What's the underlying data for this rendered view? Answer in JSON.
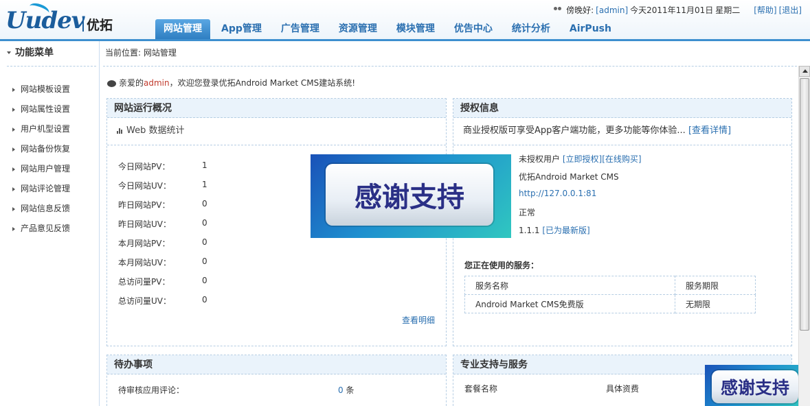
{
  "logo": {
    "brand_latin": "Uudev",
    "brand_cn": "优拓"
  },
  "userbar": {
    "greeting": "傍晚好:",
    "username": "[admin]",
    "date": "今天2011年11月01日",
    "weekday": "星期二",
    "help": "[帮助]",
    "logout": "[退出]"
  },
  "nav": [
    {
      "label": "网站管理",
      "active": true
    },
    {
      "label": "App管理"
    },
    {
      "label": "广告管理"
    },
    {
      "label": "资源管理"
    },
    {
      "label": "模块管理"
    },
    {
      "label": "优告中心"
    },
    {
      "label": "统计分析"
    },
    {
      "label": "AirPush"
    }
  ],
  "sidebar": {
    "title": "功能菜单",
    "items": [
      "网站模板设置",
      "网站属性设置",
      "用户机型设置",
      "网站备份恢复",
      "网站用户管理",
      "网站评论管理",
      "网站信息反馈",
      "产品意见反馈"
    ]
  },
  "breadcrumb": "当前位置: 网站管理",
  "welcome": {
    "prefix": "亲爱的",
    "user": "admin",
    "suffix": "，欢迎您登录优拓Android Market CMS建站系统!"
  },
  "overview": {
    "title": "网站运行概况",
    "subtitle": "Web 数据统计",
    "stats": [
      {
        "label": "今日网站PV：",
        "value": "1"
      },
      {
        "label": "今日网站UV：",
        "value": "1"
      },
      {
        "label": "昨日网站PV：",
        "value": "0"
      },
      {
        "label": "昨日网站UV：",
        "value": "0"
      },
      {
        "label": "本月网站PV：",
        "value": "0"
      },
      {
        "label": "本月网站UV：",
        "value": "0"
      },
      {
        "label": "总访问量PV：",
        "value": "0"
      },
      {
        "label": "总访问量UV：",
        "value": "0"
      }
    ],
    "more": "查看明细"
  },
  "license": {
    "title": "授权信息",
    "subtitle": "商业授权版可享受App客户端功能，更多功能等你体验...",
    "subtitle_link": "[查看详情]",
    "status_text": "未授权用户",
    "auth_link": "[立即授权]",
    "buy_link": "[在线购买]",
    "product": "优拓Android Market CMS",
    "url": "http://127.0.0.1:81",
    "state": "正常",
    "version": "1.1.1",
    "version_link": "[已为最新版]",
    "services_title": "您正在使用的服务：",
    "services_header": [
      "服务名称",
      "服务期限"
    ],
    "services_rows": [
      [
        "Android Market CMS免费版",
        "无期限"
      ]
    ]
  },
  "todo": {
    "title": "待办事项",
    "row_label": "待审核应用评论：",
    "row_count": "0",
    "row_unit": "条"
  },
  "support": {
    "title": "专业支持与服务",
    "col1": "套餐名称",
    "col2": "具体资费"
  },
  "banner": {
    "text": "感谢支持"
  },
  "colors": {
    "accent": "#2a6fb0",
    "nav_active": "#3d8fcf",
    "panel_head": "#eaf3fb",
    "highlight_user": "#c0392b"
  }
}
